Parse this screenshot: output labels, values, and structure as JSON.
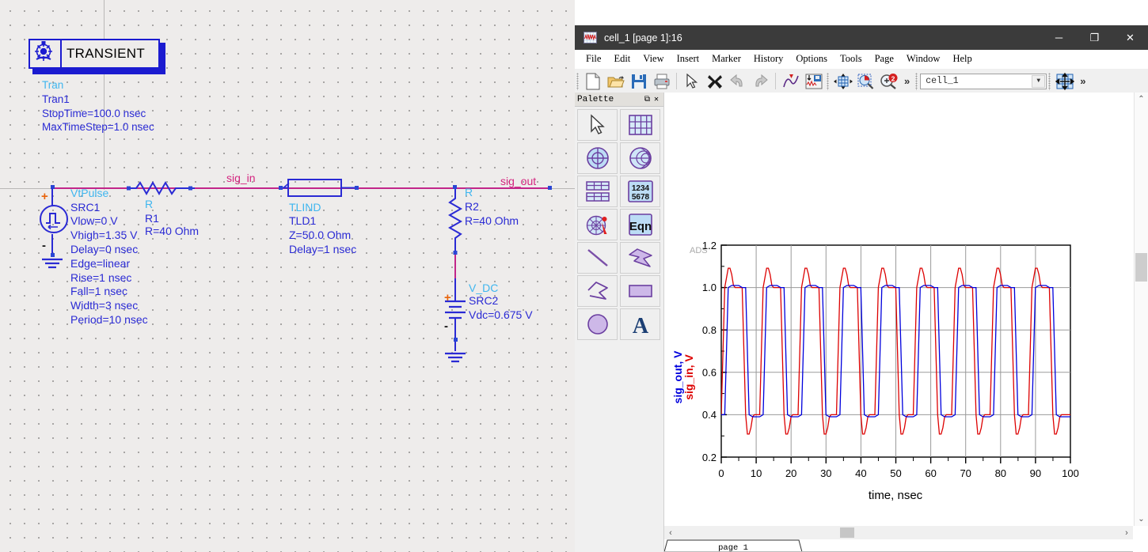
{
  "schematic": {
    "controller": {
      "title": "TRANSIENT",
      "icon": "transient-gear-icon",
      "lines": [
        {
          "text": "Tran",
          "color": "cyan"
        },
        {
          "text": "Tran1",
          "color": "blue"
        },
        {
          "text": "StopTime=100.0 nsec",
          "color": "blue"
        },
        {
          "text": "MaxTimeStep=1.0 nsec",
          "color": "blue"
        }
      ]
    },
    "source1": {
      "type": "VtPulse",
      "name": "SRC1",
      "params": [
        "Vlow=0 V",
        "Vhigh=1.35 V",
        "Delay=0 nsec",
        "Edge=linear",
        "Rise=1 nsec",
        "Fall=1 nsec",
        "Width=3 nsec",
        "Period=10 nsec"
      ],
      "plus": "+",
      "minus": "-"
    },
    "r1": {
      "type": "R",
      "name": "R1",
      "value": "R=40 Ohm"
    },
    "tline": {
      "type": "TLIND",
      "name": "TLD1",
      "params": [
        "Z=50.0 Ohm",
        "Delay=1 nsec"
      ]
    },
    "r2": {
      "type": "R",
      "name": "R2",
      "value": "R=40 Ohm"
    },
    "source2": {
      "type": "V_DC",
      "name": "SRC2",
      "value": "Vdc=0.675 V",
      "plus": "+",
      "minus": "-"
    },
    "net_labels": {
      "sig_in": "sig_in",
      "sig_out": "sig_out"
    }
  },
  "window": {
    "title": "cell_1 [page 1]:16",
    "icon": "ads-data-display-icon",
    "controls": {
      "minimize": "─",
      "maximize": "❐",
      "close": "✕"
    },
    "menu": [
      "File",
      "Edit",
      "View",
      "Insert",
      "Marker",
      "History",
      "Options",
      "Tools",
      "Page",
      "Window",
      "Help"
    ],
    "toolbar": {
      "icons": [
        "new-page-icon",
        "open-folder-icon",
        "save-icon",
        "print-icon",
        "select-arrow-icon",
        "delete-x-icon",
        "undo-icon",
        "redo-icon",
        "insert-plot-icon",
        "write-data-icon",
        "pan-icon",
        "zoom-area-icon",
        "zoom-in-icon"
      ],
      "overflow_label": "»",
      "cell_selector_value": "cell_1",
      "cell_selector_arrow": "▼",
      "last_icon": "move-grid-icon",
      "last_overflow": "»"
    },
    "palette": {
      "title": "Palette",
      "undock_label": "⧉",
      "close_label": "✕",
      "items": [
        "select-arrow-icon",
        "rectangular-plot-icon",
        "polar-plot-icon",
        "smith-chart-icon",
        "list-table-icon",
        "numeric-1234-5678-icon",
        "antenna-pattern-icon",
        "equation-eqn-icon",
        "line-tool-icon",
        "polygon-tool-icon",
        "polyline-tool-icon",
        "rectangle-tool-icon",
        "circle-tool-icon",
        "text-tool-icon"
      ]
    },
    "statusbar": {
      "page_tab": "page 1",
      "hscroll_left": "‹",
      "hscroll_right": "›",
      "vscroll_up": "⌃",
      "vscroll_down": "⌄"
    }
  },
  "chart_data": {
    "type": "line",
    "title": "",
    "watermark": "ADS",
    "xlabel": "time, nsec",
    "ylabels": [
      {
        "text": "sig_out, V",
        "color": "#0000dd"
      },
      {
        "text": "sig_in, V",
        "color": "#dd0000"
      }
    ],
    "xlim": [
      0,
      100
    ],
    "ylim": [
      0.2,
      1.2
    ],
    "xticks": [
      0,
      10,
      20,
      30,
      40,
      50,
      60,
      70,
      80,
      90,
      100
    ],
    "xtick_labels": [
      "0",
      "10",
      "20",
      "30",
      "40",
      "50",
      "60",
      "70",
      "80",
      "90",
      "100"
    ],
    "yticks": [
      0.2,
      0.4,
      0.6,
      0.8,
      1.0,
      1.2
    ],
    "ytick_labels": [
      "0.2",
      "0.4",
      "0.6",
      "0.8",
      "1.0",
      "1.2"
    ],
    "xminor_step": 5,
    "yminor_step": 0.1,
    "grid": true,
    "legend": "none",
    "series": [
      {
        "name": "sig_out, V",
        "color": "#0000dd",
        "description": "Delayed trapezoidal pulse train, low 0.34 V, high 1.01 V, period 10 nsec, width 3 nsec, rise/fall 1 nsec, delayed ~1 nsec by the 1 nsec transmission line",
        "low": 0.34,
        "high": 1.01,
        "period": 10,
        "width": 3,
        "rise": 1,
        "fall": 1,
        "delay": 1.9
      },
      {
        "name": "sig_in, V",
        "color": "#dd0000",
        "description": "Source-side pulse train showing reflection overshoot to 1.09 V on the high plateau and undershoot to 0.265 V on the low plateau, returning after 2 nsec round-trip delay",
        "low": 0.34,
        "high": 1.01,
        "overshoot": 1.09,
        "undershoot": 0.265,
        "period": 10,
        "width": 3,
        "rise": 1,
        "fall": 1,
        "delay": 0.9
      }
    ]
  }
}
